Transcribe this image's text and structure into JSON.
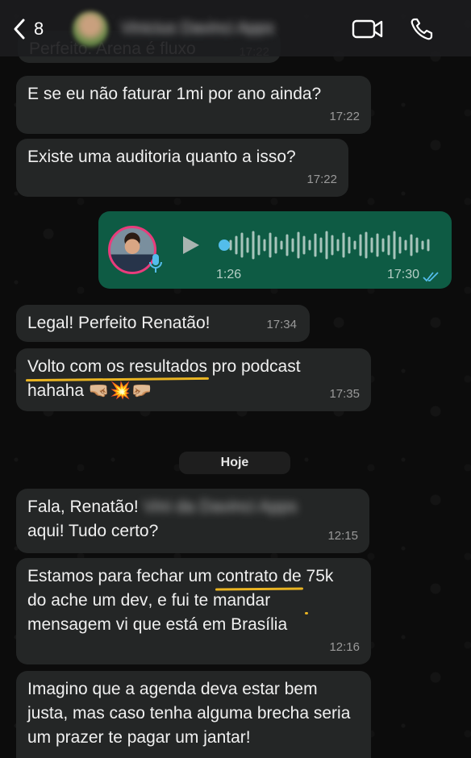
{
  "header": {
    "back_count": "8",
    "contact_name": "Vinicius Davinci Apps"
  },
  "messages": [
    {
      "text": "Perfeito. Arena é fluxo",
      "time": "17:22"
    },
    {
      "text": "E se eu não faturar 1mi por ano ainda?",
      "time": "17:22"
    },
    {
      "text": "Existe uma auditoria quanto a isso?",
      "time": "17:22"
    },
    {
      "text": "Legal! Perfeito Renatão!",
      "time": "17:34"
    },
    {
      "text_underlined": "Volto com os resultados",
      "text_rest": " pro podcast hahaha 🤜🏼💥🤛🏼",
      "time": "17:35"
    },
    {
      "text_a": "Fala, Renatão!",
      "text_blurred": "Vini da Davinci Apps",
      "text_b": "aqui! Tudo certo?",
      "time": "12:15"
    },
    {
      "text_a": "Estamos para fechar um ",
      "text_underlined_1": "contrato de",
      "text_underlined_2": "75k do ache um dev",
      "text_b": ", e fui te mandar mensagem vi que está em Brasília",
      "time": "12:16"
    },
    {
      "text": "Imagino que a agenda deva estar bem justa, mas caso tenha alguma brecha seria um prazer te pagar um jantar!"
    }
  ],
  "voice_note": {
    "duration": "1:26",
    "time": "17:30",
    "status": "read"
  },
  "day_separator": "Hoje",
  "colors": {
    "outgoing_bubble": "#0e5b44",
    "incoming_bubble": "#242626",
    "underline": "#e9b422",
    "read_ticks": "#53bdeb",
    "avatar_ring": "#e93c7c"
  }
}
